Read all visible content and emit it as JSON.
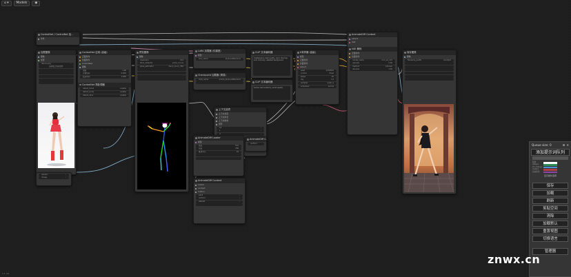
{
  "topbar": {
    "menu_label": "⌂ ▾",
    "models_label": "Models",
    "eye_label": "◉"
  },
  "nodes": {
    "controlnet_top": {
      "title": "ControlNet / ControlNet 加...",
      "r1": "条件",
      "r2": "ControlNet"
    },
    "image_load": {
      "title": "加载图像",
      "r1": "图像",
      "r2": "遮罩",
      "btn": "选择要上传的文件",
      "file": "dance.png"
    },
    "mask_box": {
      "title": "ControlNet/Mask",
      "w1": "upload",
      "w2": "image"
    },
    "openpose_pre": {
      "title": "ControlNet 预处理器",
      "rows": [
        "detect_hand",
        "detect_body",
        "detect_face",
        "resolution",
        "bbox_detector",
        "pose_estimator"
      ],
      "vals": [
        "enable",
        "enable",
        "enable",
        "512",
        "yolox_l.onnx",
        "dw-ll_ucoco_384"
      ]
    },
    "controlnet_apply": {
      "title": "ControlNet 应用 (高级)",
      "rows": [
        "正面条件",
        "负面条件",
        "ControlNet",
        "图像"
      ],
      "wlabels": [
        "强度",
        "开始时间",
        "结束时间"
      ],
      "wvals": [
        "1.00",
        "0.000",
        "1.000"
      ]
    },
    "preview_pose": {
      "title": "预览图像",
      "r1": "图像"
    },
    "lora_loader": {
      "title": "LoRA 加载器 (仅模型)",
      "r1": "模型",
      "w1": "lora_name",
      "v1": "style.safetensors"
    },
    "ckpt_loader": {
      "title": "Checkpoint 加载器 (简易)",
      "r1": "模型",
      "r2": "CLIP",
      "r3": "VAE",
      "w1": "ckpt_name",
      "v1": "anime_style.safetensors"
    },
    "clip_pos": {
      "title": "CLIP 文本编码器",
      "text": "masterpiece, best quality, 1girl, dancing, solo, full body, detailed background"
    },
    "clip_neg": {
      "title": "CLIP 文本编码器",
      "text": "lowres, bad anatomy, worst quality"
    },
    "animatediff_top": {
      "title": "AnimateDiff Context"
    },
    "animatediff_mid": {
      "title": "AnimateDiff Loader"
    },
    "ad_opts": {
      "title": "上下文选项",
      "rows": [
        "上下文长度",
        "上下文步长",
        "上下文重叠",
        "闭环"
      ],
      "vals": [
        "16",
        "1",
        "4",
        "false"
      ]
    },
    "ad_settings": {
      "title": "AnimateDiff Context"
    },
    "ksampler": {
      "title": "K采样器 (高级)",
      "rows": [
        "模型",
        "正面条件",
        "负面条件",
        "Latent"
      ],
      "wlabels": [
        "seed",
        "control",
        "steps",
        "cfg",
        "sampler",
        "scheduler",
        "denoise"
      ],
      "wvals": [
        "1234567",
        "fixed",
        "20",
        "7.0",
        "euler_a",
        "karras",
        "1.00"
      ]
    },
    "vae_decode": {
      "title": "VAE 解码",
      "r1": "Latent",
      "r2": "VAE"
    },
    "animatediff_right": {
      "title": "AnimateDiff Context"
    },
    "save_image": {
      "title": "保存图像",
      "w1": "filename_prefix",
      "v1": "ComfyUI"
    },
    "upscale": {
      "title": "AnimateDiff Upscale",
      "rows": [
        "model_name",
        "upscale",
        "method"
      ],
      "vals": [
        "mm_sd_v15",
        "2.00",
        "bilinear"
      ]
    },
    "ad_loader2": {
      "title": "AnimateDiff Context",
      "rows": [
        "model",
        "context",
        "motion"
      ],
      "vals": [
        "sd15",
        "uniform",
        "default"
      ]
    },
    "empty_latent": {
      "title": "空Latent",
      "rows": [
        "宽度",
        "高度",
        "批次大小"
      ],
      "vals": [
        "512",
        "768",
        "16"
      ]
    }
  },
  "queue": {
    "title": "Queue size: 0",
    "gear": "⚙",
    "close": "✕",
    "primary_btn": "添加提示词队列",
    "batch_label": "批次",
    "options": [
      "禁用",
      "Always",
      "On change",
      "Instant",
      "自动队列"
    ],
    "extra_label": "显示额外选项",
    "buttons": [
      "保存",
      "加载",
      "刷新",
      "剪贴空间",
      "清除",
      "加载默认",
      "重置视图",
      "切换语言"
    ],
    "manager": "管理器",
    "bar_colors": [
      "#ffffff",
      "#2e8b57",
      "#4a90d9",
      "#b04040",
      "#8e44ad"
    ]
  },
  "watermark": "znwx.cn",
  "footer": "1.1 ms"
}
